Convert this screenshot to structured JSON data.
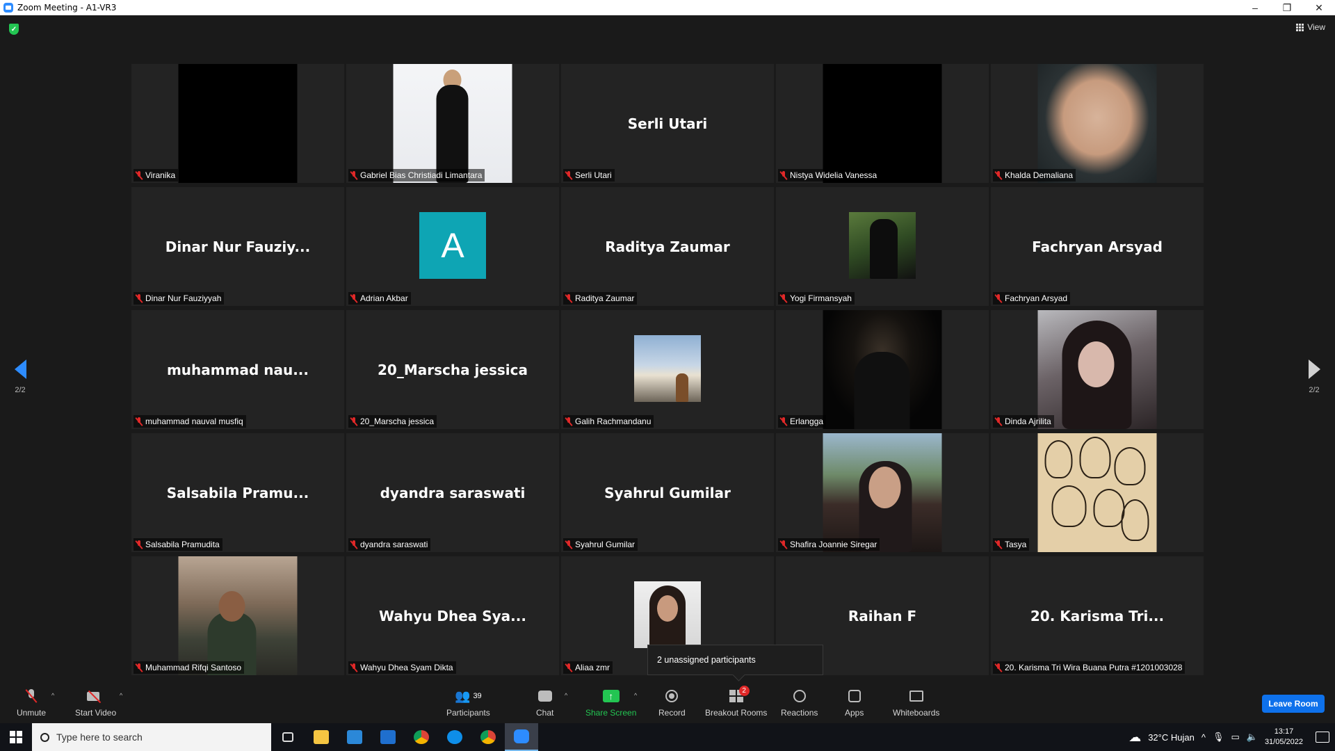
{
  "window": {
    "title": "Zoom Meeting - A1-VR3",
    "minimize": "–",
    "maximize": "❐",
    "close": "✕"
  },
  "header": {
    "view_label": "View"
  },
  "nav": {
    "prev_page": "2/2",
    "next_page": "2/2"
  },
  "tiles": [
    {
      "label": "Viranika",
      "big": "",
      "photo": "black",
      "size": "tall"
    },
    {
      "label": "Gabriel Bias Christiadi Limantara",
      "big": "",
      "photo": "white",
      "size": "tall"
    },
    {
      "label": "Serli Utari",
      "big": "Serli Utari",
      "photo": "",
      "size": ""
    },
    {
      "label": "Nistya Widelia Vanessa",
      "big": "",
      "photo": "black",
      "size": "tall"
    },
    {
      "label": "Khalda Demaliana",
      "big": "",
      "photo": "face",
      "size": "tall"
    },
    {
      "label": "Dinar Nur Fauziyyah",
      "big": "Dinar Nur Fauziy...",
      "photo": "",
      "size": ""
    },
    {
      "label": "Adrian Akbar",
      "big": "",
      "photo": "avatar-a",
      "size": "small",
      "avatar_letter": "A"
    },
    {
      "label": "Raditya Zaumar",
      "big": "Raditya Zaumar",
      "photo": "",
      "size": ""
    },
    {
      "label": "Yogi Firmansyah",
      "big": "",
      "photo": "forest",
      "size": "small"
    },
    {
      "label": "Fachryan Arsyad",
      "big": "Fachryan Arsyad",
      "photo": "",
      "size": ""
    },
    {
      "label": "muhammad nauval musfiq",
      "big": "muhammad nau...",
      "photo": "",
      "size": ""
    },
    {
      "label": "20_Marscha jessica",
      "big": "20_Marscha jessica",
      "photo": "",
      "size": ""
    },
    {
      "label": "Galih Rachmandanu",
      "big": "",
      "photo": "sky",
      "size": "small"
    },
    {
      "label": "Erlangga",
      "big": "",
      "photo": "dark",
      "size": "tall"
    },
    {
      "label": "Dinda Ajrilita",
      "big": "",
      "photo": "girl",
      "size": "tall"
    },
    {
      "label": "Salsabila Pramudita",
      "big": "Salsabila Pramu...",
      "photo": "",
      "size": ""
    },
    {
      "label": "dyandra saraswati",
      "big": "dyandra saraswati",
      "photo": "",
      "size": ""
    },
    {
      "label": "Syahrul Gumilar",
      "big": "Syahrul Gumilar",
      "photo": "",
      "size": ""
    },
    {
      "label": "Shafira Joannie Siregar",
      "big": "",
      "photo": "car",
      "size": "tall"
    },
    {
      "label": "Tasya",
      "big": "",
      "photo": "sketch",
      "size": "tall"
    },
    {
      "label": "Muhammad Rifqi Santoso",
      "big": "",
      "photo": "crowd",
      "size": "tall"
    },
    {
      "label": "Wahyu Dhea Syam Dikta",
      "big": "Wahyu Dhea Sya...",
      "photo": "",
      "size": ""
    },
    {
      "label": "Aliaa zmr",
      "big": "",
      "photo": "selfie",
      "size": "small"
    },
    {
      "label": "",
      "big": "Raihan F",
      "photo": "",
      "size": ""
    },
    {
      "label": "20. Karisma Tri Wira Buana Putra #1201003028",
      "big": "20. Karisma Tri...",
      "photo": "",
      "size": ""
    }
  ],
  "popup": {
    "text": "2 unassigned participants"
  },
  "toolbar": {
    "unmute": "Unmute",
    "start_video": "Start Video",
    "participants": "Participants",
    "participants_count": "39",
    "chat": "Chat",
    "share_screen": "Share Screen",
    "record": "Record",
    "breakout_rooms": "Breakout Rooms",
    "breakout_badge": "2",
    "reactions": "Reactions",
    "apps": "Apps",
    "whiteboards": "Whiteboards",
    "leave": "Leave Room"
  },
  "taskbar": {
    "search_placeholder": "Type here to search",
    "weather": "32°C  Hujan",
    "time": "13:17",
    "date": "31/05/2022"
  },
  "colors": {
    "accent": "#2d8cff",
    "share_green": "#23c552",
    "muted_red": "#e02828",
    "leave_blue": "#0e71eb"
  }
}
